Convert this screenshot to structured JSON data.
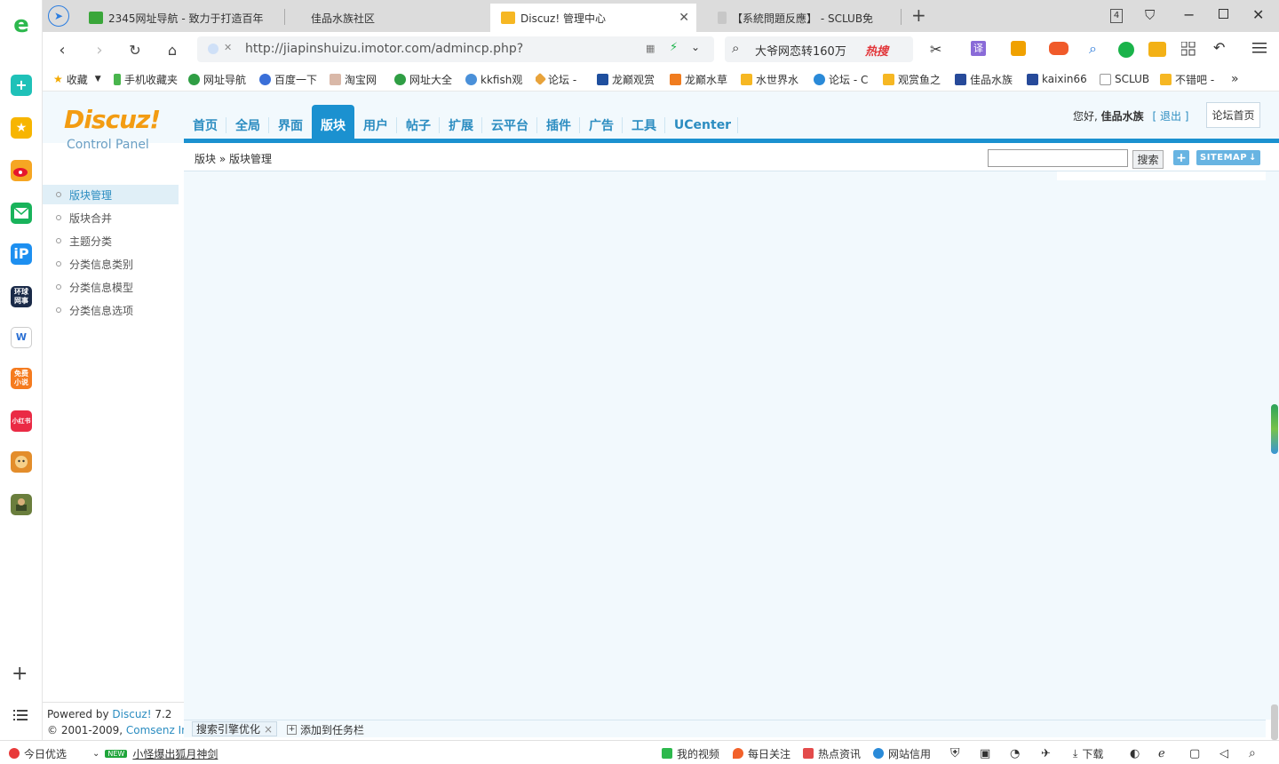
{
  "browser": {
    "tabs": [
      {
        "title": "2345网址导航 - 致力于打造百年"
      },
      {
        "title": "佳品水族社区"
      },
      {
        "title": "Discuz! 管理中心"
      },
      {
        "title": "【系統問題反應】 - SCLUB免"
      }
    ],
    "tab_count": "4",
    "url": "http://jiapinshuizu.imotor.com/admincp.php?",
    "url_domain": "jiapinshuizu.imotor.com",
    "search_text": "大爷网恋转160万",
    "search_tag": "热搜",
    "translate_label": "译",
    "bookmarks": [
      "收藏",
      "手机收藏夹",
      "网址导航",
      "百度一下",
      "淘宝网",
      "网址大全",
      "kkfish观",
      "论坛 -",
      "龙巅观赏",
      "龙巅水草",
      "水世界水",
      "论坛 - C",
      "观赏鱼之",
      "佳品水族",
      "kaixin66",
      "SCLUB",
      "不错吧 -"
    ],
    "bookmarks_more": "»"
  },
  "sidebar_apps": {
    "news_label": "环球\n网事",
    "novel_label": "免费\n小说",
    "red_label": "小红书"
  },
  "discuz": {
    "logo_title": "Discuz!",
    "logo_subtitle": "Control Panel",
    "greeting": "您好,",
    "username": "佳品水族",
    "logout": "[ 退出 ]",
    "forum_home": "论坛首页",
    "menu": [
      "首页",
      "全局",
      "界面",
      "版块",
      "用户",
      "帖子",
      "扩展",
      "云平台",
      "插件",
      "广告",
      "工具",
      "UCenter"
    ],
    "active_menu": "版块",
    "breadcrumb": [
      "版块",
      "»",
      "版块管理"
    ],
    "search_button": "搜索",
    "plus_button": "+",
    "sitemap_button": "SITEMAP",
    "side_menu": [
      "版块管理",
      "版块合并",
      "主题分类",
      "分类信息类别",
      "分类信息模型",
      "分类信息选项"
    ],
    "powered_by": "Powered by",
    "powered_product": "Discuz!",
    "powered_version": "7.2",
    "copyright": "© 2001-2009,",
    "copyright_company": "Comsenz Inc.",
    "taskbar_item": "搜索引擎优化",
    "taskbar_close": "×",
    "taskbar_add": "添加到任务栏"
  },
  "statusbar": {
    "today": "今日优选",
    "new_badge": "NEW",
    "headline": "小怪爆出狐月神剑",
    "video": "我的视频",
    "follow": "每日关注",
    "hot_news": "热点资讯",
    "credit": "网站信用",
    "download": "下载"
  }
}
